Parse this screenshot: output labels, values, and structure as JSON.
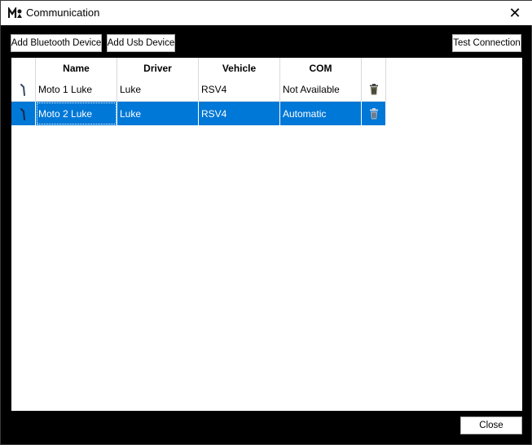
{
  "window": {
    "title": "Communication",
    "close_symbol": "✕",
    "app_icon": "app-logo-icon"
  },
  "toolbar": {
    "add_bluetooth_label": "Add Bluetooth Device",
    "add_usb_label": "Add Usb Device",
    "test_connection_label": "Test Connection"
  },
  "table": {
    "columns": [
      "",
      "Name",
      "Driver",
      "Vehicle",
      "COM",
      ""
    ],
    "rows": [
      {
        "icon": "connector-icon",
        "name": "Moto 1 Luke",
        "driver": "Luke",
        "vehicle": "RSV4",
        "com": "Not Available",
        "action_icon": "trash-icon",
        "selected": false
      },
      {
        "icon": "connector-icon",
        "name": "Moto 2 Luke",
        "driver": "Luke",
        "vehicle": "RSV4",
        "com": "Automatic",
        "action_icon": "trash-icon",
        "selected": true
      }
    ]
  },
  "footer": {
    "close_label": "Close"
  },
  "colors": {
    "selection": "#0078d7",
    "background": "#000000",
    "grid_background": "#ffffff"
  }
}
